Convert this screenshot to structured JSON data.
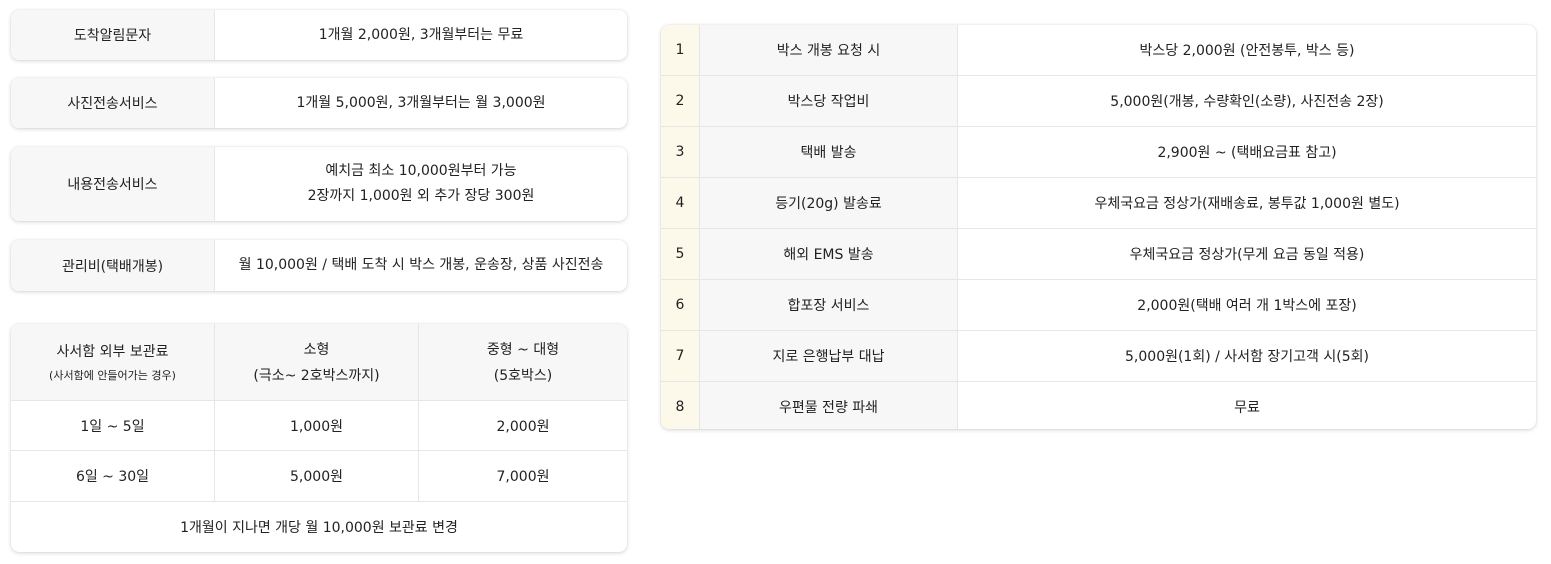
{
  "services": [
    {
      "label": "도착알림문자",
      "lines": [
        "1개월 2,000원, 3개월부터는 무료"
      ]
    },
    {
      "label": "사진전송서비스",
      "lines": [
        "1개월 5,000원, 3개월부터는 월 3,000원"
      ]
    },
    {
      "label": "내용전송서비스",
      "lines": [
        "예치금 최소 10,000원부터 가능",
        "2장까지 1,000원 외 추가 장당 300원"
      ]
    },
    {
      "label": "관리비(택배개봉)",
      "lines": [
        "월 10,000원 / 택배 도착 시 박스 개봉, 운송장, 상품 사진전송"
      ]
    }
  ],
  "storage": {
    "header": {
      "col1": "사서함 외부 보관료",
      "col1_note": "(사서함에 안들어가는 경우)",
      "col2": "소형",
      "col2_note": "(극소~ 2호박스까지)",
      "col3": "중형 ~ 대형",
      "col3_note": "(5호박스)"
    },
    "rows": [
      {
        "period": "1일 ~ 5일",
        "small": "1,000원",
        "large": "2,000원"
      },
      {
        "period": "6일 ~ 30일",
        "small": "5,000원",
        "large": "7,000원"
      }
    ],
    "note": "1개월이 지나면 개당 월 10,000원 보관료 변경"
  },
  "fees": [
    {
      "num": "1",
      "item": "박스 개봉 요청 시",
      "price": "박스당 2,000원 (안전봉투, 박스 등)"
    },
    {
      "num": "2",
      "item": "박스당 작업비",
      "price": "5,000원(개봉, 수량확인(소량), 사진전송 2장)"
    },
    {
      "num": "3",
      "item": "택배 발송",
      "price": "2,900원 ~ (택배요금표 참고)"
    },
    {
      "num": "4",
      "item": "등기(20g) 발송료",
      "price": "우체국요금 정상가(재배송료, 봉투값 1,000원 별도)"
    },
    {
      "num": "5",
      "item": "해외 EMS 발송",
      "price": "우체국요금 정상가(무게 요금 동일 적용)"
    },
    {
      "num": "6",
      "item": "합포장 서비스",
      "price": "2,000원(택배 여러 개 1박스에 포장)"
    },
    {
      "num": "7",
      "item": "지로 은행납부 대납",
      "price": "5,000원(1회) / 사서함 장기고객 시(5회)"
    },
    {
      "num": "8",
      "item": "우편물 전량 파쇄",
      "price": "무료"
    }
  ],
  "colors": {
    "label_bg": "#f7f7f7",
    "number_bg": "#fdf9ea",
    "border": "#e6e6e6"
  }
}
